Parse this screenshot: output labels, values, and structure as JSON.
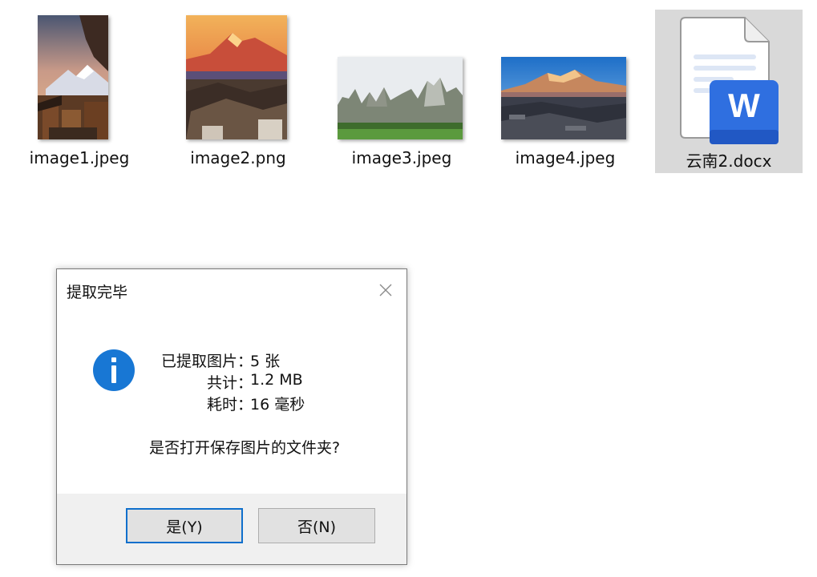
{
  "files": [
    {
      "name": "image1.jpeg",
      "icon": "photo-thumbnail"
    },
    {
      "name": "image2.png",
      "icon": "photo-thumbnail"
    },
    {
      "name": "image3.jpeg",
      "icon": "photo-thumbnail"
    },
    {
      "name": "image4.jpeg",
      "icon": "photo-thumbnail"
    },
    {
      "name": "云南2.docx",
      "icon": "word-document-icon",
      "selected": true
    }
  ],
  "word_icon": {
    "letter": "W",
    "color": "#2f6fe0"
  },
  "dialog": {
    "title": "提取完毕",
    "close_icon": "close-icon",
    "info_icon": "info-icon",
    "stats": [
      {
        "label": "已提取图片：",
        "value": "5 张"
      },
      {
        "label": "共计：",
        "value": "1.2 MB"
      },
      {
        "label": "耗时：",
        "value": "16 毫秒"
      }
    ],
    "question": "是否打开保存图片的文件夹?",
    "yes_label": "是(Y)",
    "no_label": "否(N)"
  },
  "colors": {
    "accent": "#1877d4",
    "selection": "#d9d9d9",
    "footer": "#f0f0f0"
  }
}
